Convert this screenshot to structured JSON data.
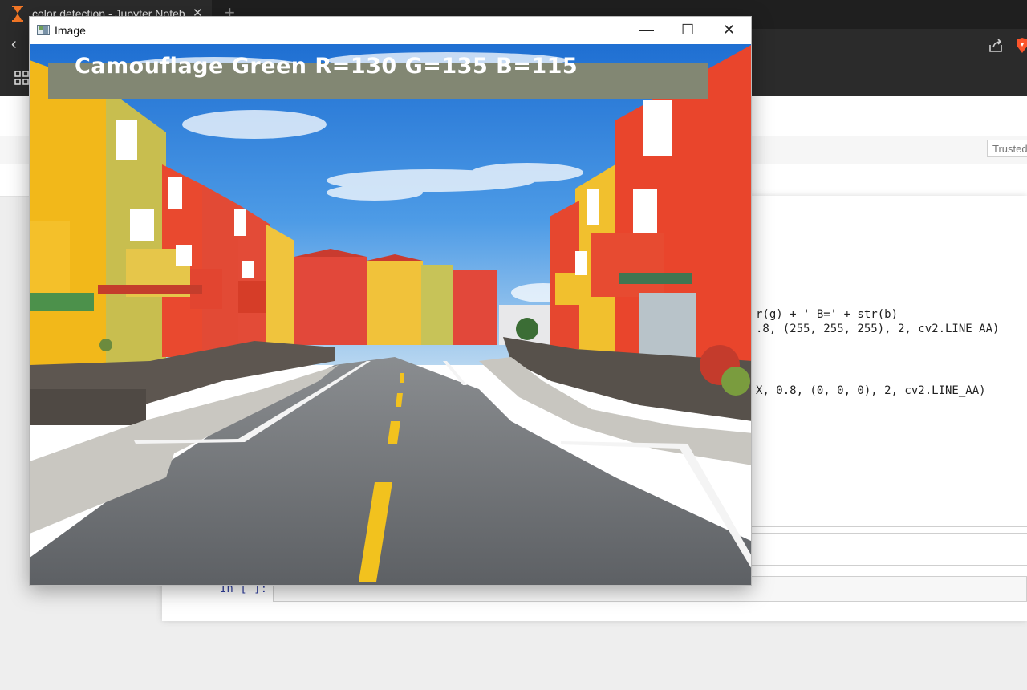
{
  "browser": {
    "tab_title": "color detection - Jupyter Notebo",
    "tab_close": "✕",
    "new_tab": "+",
    "back": "‹"
  },
  "jupyter": {
    "trusted_label": "Trusted",
    "code_lines": [
      "r(g) + ' B=' + str(b)",
      ".8, (255, 255, 255), 2, cv2.LINE_AA)",
      "X, 0.8, (0, 0, 0), 2, cv2.LINE_AA)"
    ],
    "in_prompt": "In [ ]:"
  },
  "cv_window": {
    "title": "Image",
    "minimize": "—",
    "maximize": "☐",
    "close": "✕",
    "overlay_text": "Camouflage Green R=130 G=135 B=115",
    "overlay_color": "#828773"
  },
  "colors": {
    "camouflage_green": "#828773"
  },
  "icons": [
    "hourglass-icon",
    "share-icon",
    "brave-lion-icon",
    "apps-grid-icon",
    "window-app-icon"
  ]
}
